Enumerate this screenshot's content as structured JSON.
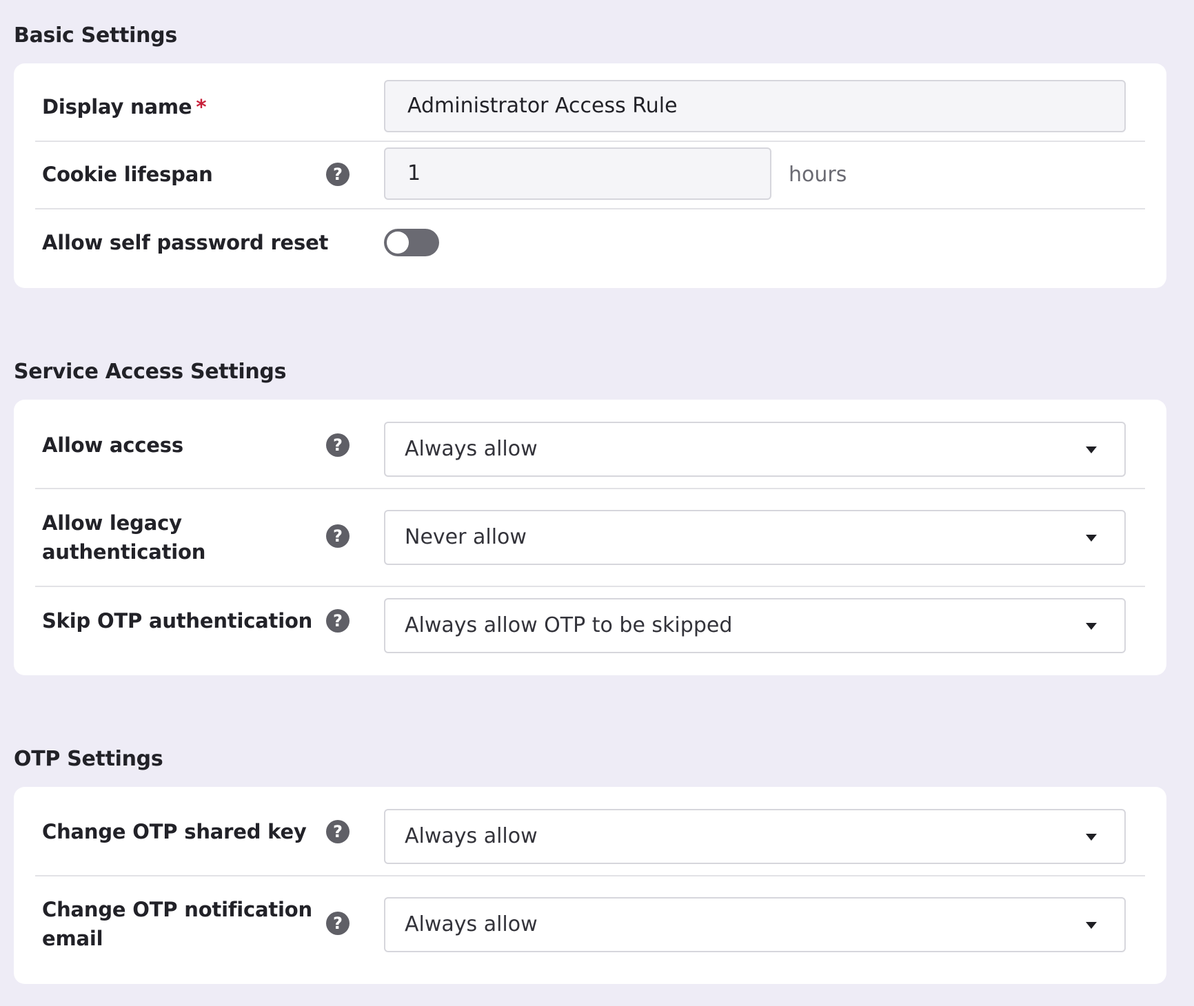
{
  "basic_settings": {
    "title": "Basic Settings",
    "display_name": {
      "label": "Display name",
      "required_mark": "*",
      "value": "Administrator Access Rule"
    },
    "cookie_lifespan": {
      "label": "Cookie lifespan",
      "value": "1",
      "unit": "hours"
    },
    "self_password_reset": {
      "label": "Allow self password reset",
      "enabled": false
    }
  },
  "service_access_settings": {
    "title": "Service Access Settings",
    "allow_access": {
      "label": "Allow access",
      "value": "Always allow"
    },
    "legacy_auth": {
      "label_line1": "Allow legacy",
      "label_line2": "authentication",
      "value": "Never allow"
    },
    "skip_otp": {
      "label": "Skip OTP authentication",
      "value": "Always allow OTP to be skipped"
    }
  },
  "otp_settings": {
    "title": "OTP Settings",
    "change_shared_key": {
      "label": "Change OTP shared key",
      "value": "Always allow"
    },
    "change_notification_email": {
      "label_line1": "Change OTP notification",
      "label_line2": "email",
      "value": "Always allow"
    }
  },
  "icons": {
    "help": "?"
  }
}
